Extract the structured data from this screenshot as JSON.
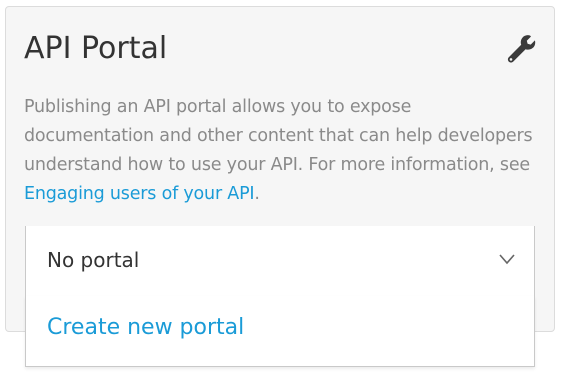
{
  "panel": {
    "title": "API Portal",
    "settings_icon": "wrench-icon",
    "description_text": "Publishing an API portal allows you to expose documentation and other content that can help developers understand how to use your API. For more information, see ",
    "description_link": "Engaging users of your API",
    "description_end": "."
  },
  "portal_select": {
    "selected": "No portal",
    "options": [
      "Create new portal"
    ]
  },
  "colors": {
    "link": "#1a9bd7",
    "text": "#333333",
    "muted": "#8a8a8a",
    "panel_bg": "#f6f6f6"
  }
}
